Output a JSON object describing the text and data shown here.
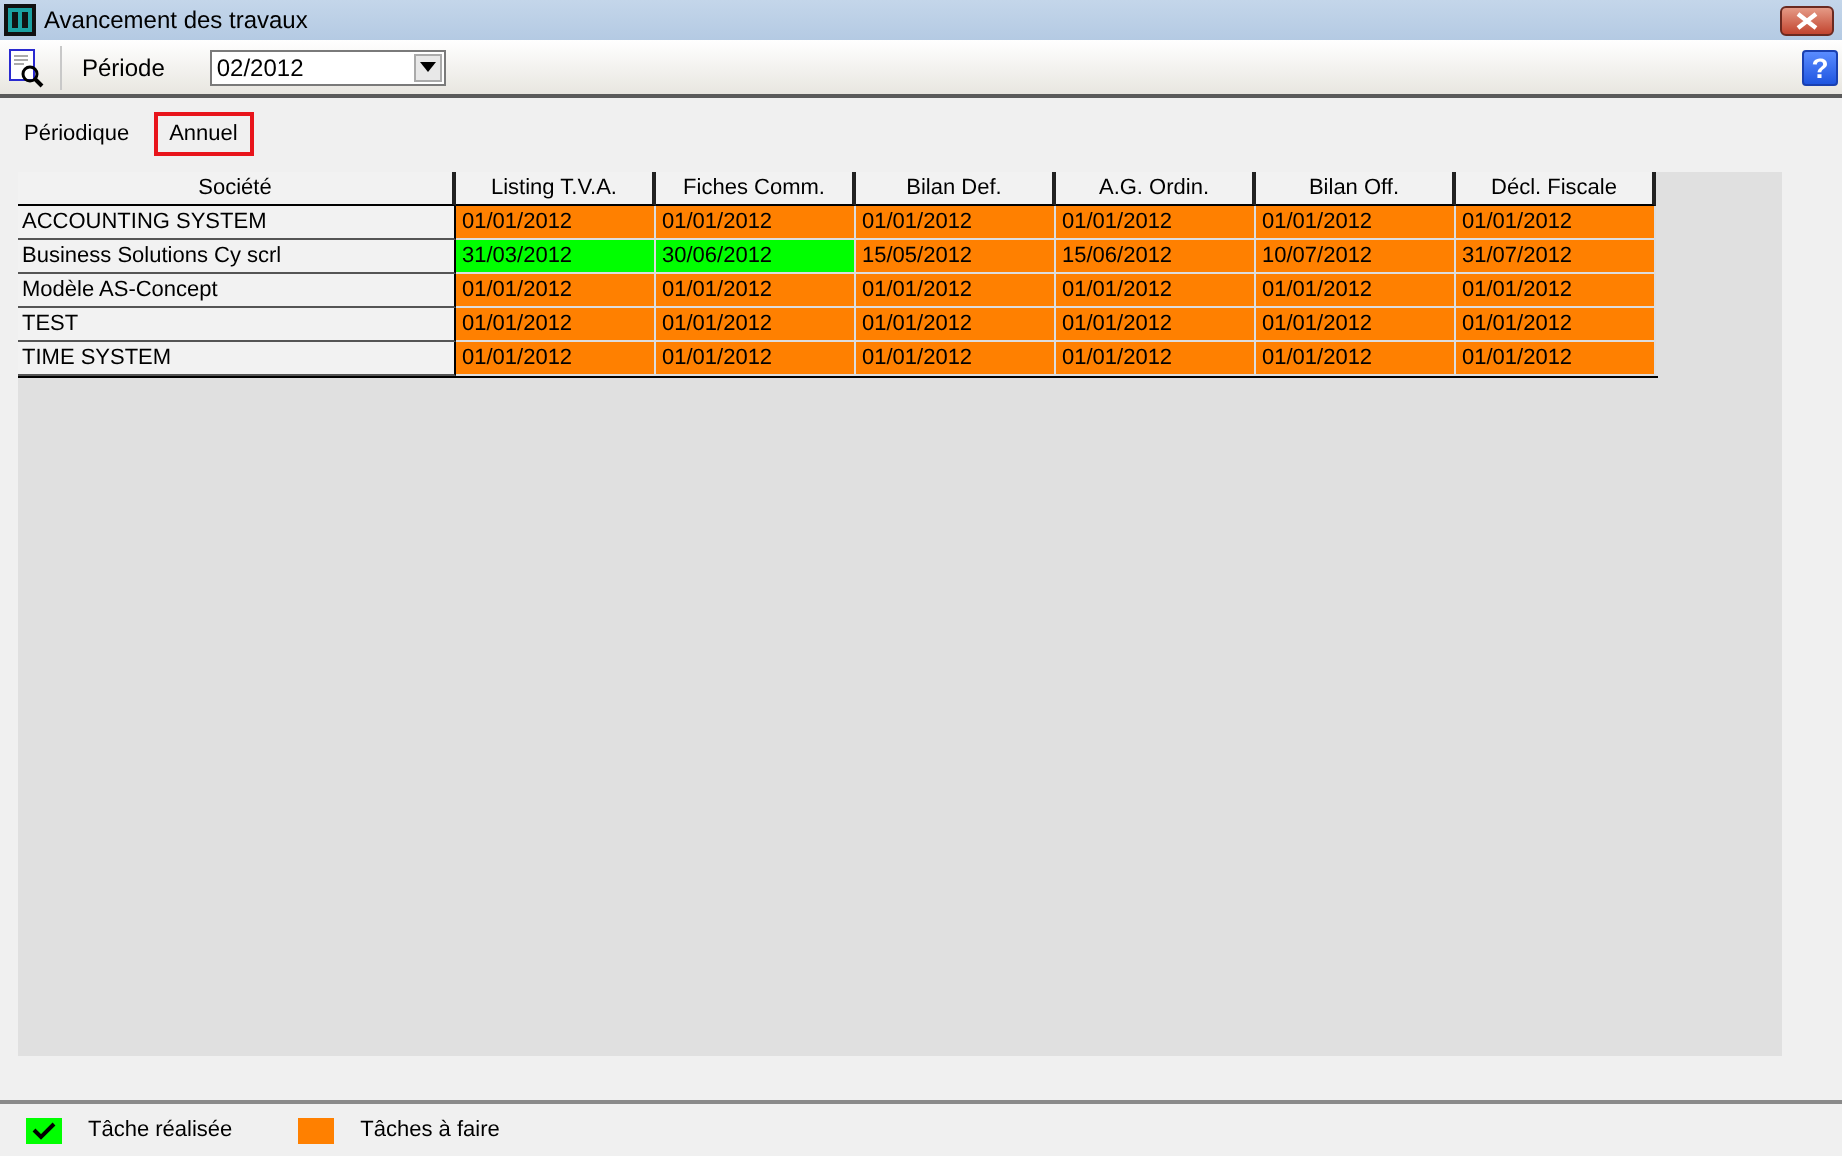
{
  "window": {
    "title": "Avancement des travaux"
  },
  "toolbar": {
    "period_label": "Période",
    "period_value": "02/2012",
    "help_label": "?"
  },
  "tabs": [
    {
      "label": "Périodique",
      "selected": false
    },
    {
      "label": "Annuel",
      "selected": true
    }
  ],
  "table": {
    "columns": [
      "Société",
      "Listing T.V.A.",
      "Fiches Comm.",
      "Bilan Def.",
      "A.G. Ordin.",
      "Bilan Off.",
      "Décl. Fiscale"
    ],
    "rows": [
      {
        "cells": [
          {
            "text": "ACCOUNTING SYSTEM"
          },
          {
            "text": "01/01/2012",
            "done": false
          },
          {
            "text": "01/01/2012",
            "done": false
          },
          {
            "text": "01/01/2012",
            "done": false
          },
          {
            "text": "01/01/2012",
            "done": false
          },
          {
            "text": "01/01/2012",
            "done": false
          },
          {
            "text": "01/01/2012",
            "done": false
          }
        ]
      },
      {
        "cells": [
          {
            "text": "Business Solutions Cy scrl"
          },
          {
            "text": "31/03/2012",
            "done": true
          },
          {
            "text": "30/06/2012",
            "done": true
          },
          {
            "text": "15/05/2012",
            "done": false
          },
          {
            "text": "15/06/2012",
            "done": false
          },
          {
            "text": "10/07/2012",
            "done": false
          },
          {
            "text": "31/07/2012",
            "done": false
          }
        ]
      },
      {
        "cells": [
          {
            "text": "Modèle AS-Concept"
          },
          {
            "text": "01/01/2012",
            "done": false
          },
          {
            "text": "01/01/2012",
            "done": false
          },
          {
            "text": "01/01/2012",
            "done": false
          },
          {
            "text": "01/01/2012",
            "done": false
          },
          {
            "text": "01/01/2012",
            "done": false
          },
          {
            "text": "01/01/2012",
            "done": false
          }
        ]
      },
      {
        "cells": [
          {
            "text": "TEST"
          },
          {
            "text": "01/01/2012",
            "done": false
          },
          {
            "text": "01/01/2012",
            "done": false
          },
          {
            "text": "01/01/2012",
            "done": false
          },
          {
            "text": "01/01/2012",
            "done": false
          },
          {
            "text": "01/01/2012",
            "done": false
          },
          {
            "text": "01/01/2012",
            "done": false
          }
        ]
      },
      {
        "cells": [
          {
            "text": "TIME SYSTEM"
          },
          {
            "text": "01/01/2012",
            "done": false
          },
          {
            "text": "01/01/2012",
            "done": false
          },
          {
            "text": "01/01/2012",
            "done": false
          },
          {
            "text": "01/01/2012",
            "done": false
          },
          {
            "text": "01/01/2012",
            "done": false
          },
          {
            "text": "01/01/2012",
            "done": false
          }
        ]
      }
    ]
  },
  "legend": [
    {
      "label": "Tâche réalisée",
      "kind": "done"
    },
    {
      "label": "Tâches à faire",
      "kind": "todo"
    }
  ]
}
